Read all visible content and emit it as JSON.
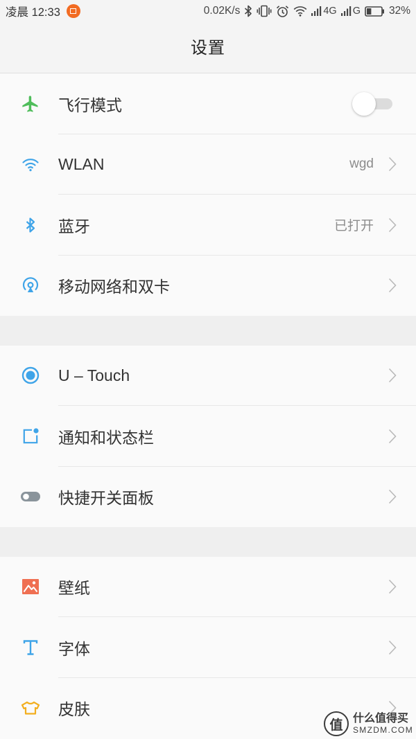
{
  "status_bar": {
    "clock": "凌晨 12:33",
    "app_icon": "notification-app-icon",
    "app_icon_color": "#f26b22",
    "net_speed": "0.02K/s",
    "icons": [
      "bluetooth-icon",
      "vibrate-icon",
      "alarm-icon",
      "wifi-icon"
    ],
    "sim1_network": "4G",
    "sim2_network": "G",
    "battery_level": 0.32,
    "battery_text": "32%"
  },
  "header": {
    "title": "设置"
  },
  "sections": [
    {
      "items": [
        {
          "label": "飞行模式",
          "icon": "airplane-icon",
          "icon_color": "#4fbd5b",
          "toggle_on": false
        },
        {
          "label": "WLAN",
          "value": "wgd",
          "icon": "wifi-icon",
          "icon_color": "#3fa4e8"
        },
        {
          "label": "蓝牙",
          "value": "已打开",
          "icon": "bluetooth-icon",
          "icon_color": "#3fa4e8"
        },
        {
          "label": "移动网络和双卡",
          "icon": "mobile-network-icon",
          "icon_color": "#3fa4e8"
        }
      ]
    },
    {
      "items": [
        {
          "label": "U – Touch",
          "icon": "u-touch-icon",
          "icon_color": "#3fa4e8"
        },
        {
          "label": "通知和状态栏",
          "icon": "notification-icon",
          "icon_color": "#3fa4e8"
        },
        {
          "label": "快捷开关面板",
          "icon": "quick-toggle-icon",
          "icon_color": "#8a949b"
        }
      ]
    },
    {
      "items": [
        {
          "label": "壁纸",
          "icon": "wallpaper-icon",
          "icon_color": "#ef6f52"
        },
        {
          "label": "字体",
          "icon": "font-icon",
          "icon_color": "#3fa4e8"
        },
        {
          "label": "皮肤",
          "icon": "skin-icon",
          "icon_color": "#f2ae1e"
        }
      ]
    }
  ],
  "watermark": {
    "logo_text": "值",
    "name": "什么值得买",
    "site": "SMZDM.COM"
  }
}
